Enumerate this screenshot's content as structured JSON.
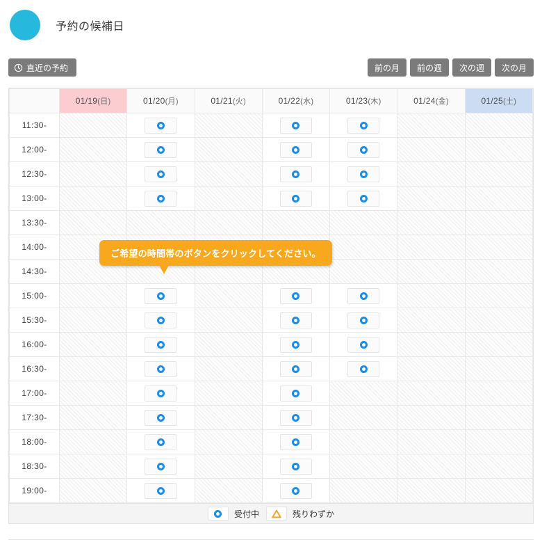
{
  "header": {
    "title": "予約の候補日",
    "dot_color": "#26b8dd"
  },
  "toolbar": {
    "recent_label": "直近の予約",
    "recent_icon": "clock-icon",
    "nav_buttons": [
      {
        "label": "前の月",
        "name": "prev-month"
      },
      {
        "label": "前の週",
        "name": "prev-week"
      },
      {
        "label": "次の週",
        "name": "next-week"
      },
      {
        "label": "次の月",
        "name": "next-month"
      }
    ]
  },
  "calendar": {
    "time_header": "",
    "columns": [
      {
        "date": "01/19",
        "dow": "(日)",
        "type": "sunday"
      },
      {
        "date": "01/20",
        "dow": "(月)",
        "type": "weekday"
      },
      {
        "date": "01/21",
        "dow": "(火)",
        "type": "weekday"
      },
      {
        "date": "01/22",
        "dow": "(水)",
        "type": "weekday"
      },
      {
        "date": "01/23",
        "dow": "(木)",
        "type": "weekday"
      },
      {
        "date": "01/24",
        "dow": "(金)",
        "type": "weekday"
      },
      {
        "date": "01/25",
        "dow": "(土)",
        "type": "saturday"
      }
    ],
    "rows": [
      {
        "time": "11:30-",
        "slots": [
          "closed",
          "open",
          "closed",
          "open",
          "open",
          "closed",
          "closed"
        ]
      },
      {
        "time": "12:00-",
        "slots": [
          "closed",
          "open",
          "closed",
          "open",
          "open",
          "closed",
          "closed"
        ]
      },
      {
        "time": "12:30-",
        "slots": [
          "closed",
          "open",
          "closed",
          "open",
          "open",
          "closed",
          "closed"
        ]
      },
      {
        "time": "13:00-",
        "slots": [
          "closed",
          "open",
          "closed",
          "open",
          "open",
          "closed",
          "closed"
        ]
      },
      {
        "time": "13:30-",
        "slots": [
          "closed",
          "closed",
          "closed",
          "closed",
          "closed",
          "closed",
          "closed"
        ]
      },
      {
        "time": "14:00-",
        "slots": [
          "closed",
          "closed",
          "closed",
          "closed",
          "closed",
          "closed",
          "closed"
        ]
      },
      {
        "time": "14:30-",
        "slots": [
          "closed",
          "closed",
          "closed",
          "closed",
          "closed",
          "closed",
          "closed"
        ]
      },
      {
        "time": "15:00-",
        "slots": [
          "closed",
          "open",
          "closed",
          "open",
          "open",
          "closed",
          "closed"
        ]
      },
      {
        "time": "15:30-",
        "slots": [
          "closed",
          "open",
          "closed",
          "open",
          "open",
          "closed",
          "closed"
        ]
      },
      {
        "time": "16:00-",
        "slots": [
          "closed",
          "open",
          "closed",
          "open",
          "open",
          "closed",
          "closed"
        ]
      },
      {
        "time": "16:30-",
        "slots": [
          "closed",
          "open",
          "closed",
          "open",
          "open",
          "closed",
          "closed"
        ]
      },
      {
        "time": "17:00-",
        "slots": [
          "closed",
          "open",
          "closed",
          "open",
          "closed",
          "closed",
          "closed"
        ]
      },
      {
        "time": "17:30-",
        "slots": [
          "closed",
          "open",
          "closed",
          "open",
          "closed",
          "closed",
          "closed"
        ]
      },
      {
        "time": "18:00-",
        "slots": [
          "closed",
          "open",
          "closed",
          "open",
          "closed",
          "closed",
          "closed"
        ]
      },
      {
        "time": "18:30-",
        "slots": [
          "closed",
          "open",
          "closed",
          "open",
          "closed",
          "closed",
          "closed"
        ]
      },
      {
        "time": "19:00-",
        "slots": [
          "closed",
          "open",
          "closed",
          "open",
          "closed",
          "closed",
          "closed"
        ]
      }
    ]
  },
  "tooltip": {
    "text": "ご希望の時間帯のボタンをクリックしてください。",
    "background": "#f8a81d"
  },
  "legend": {
    "items": [
      {
        "icon": "circle-icon",
        "label": "受付中",
        "color": "#1e8ce0"
      },
      {
        "icon": "triangle-icon",
        "label": "残りわずか",
        "color": "#f5a623"
      }
    ]
  }
}
